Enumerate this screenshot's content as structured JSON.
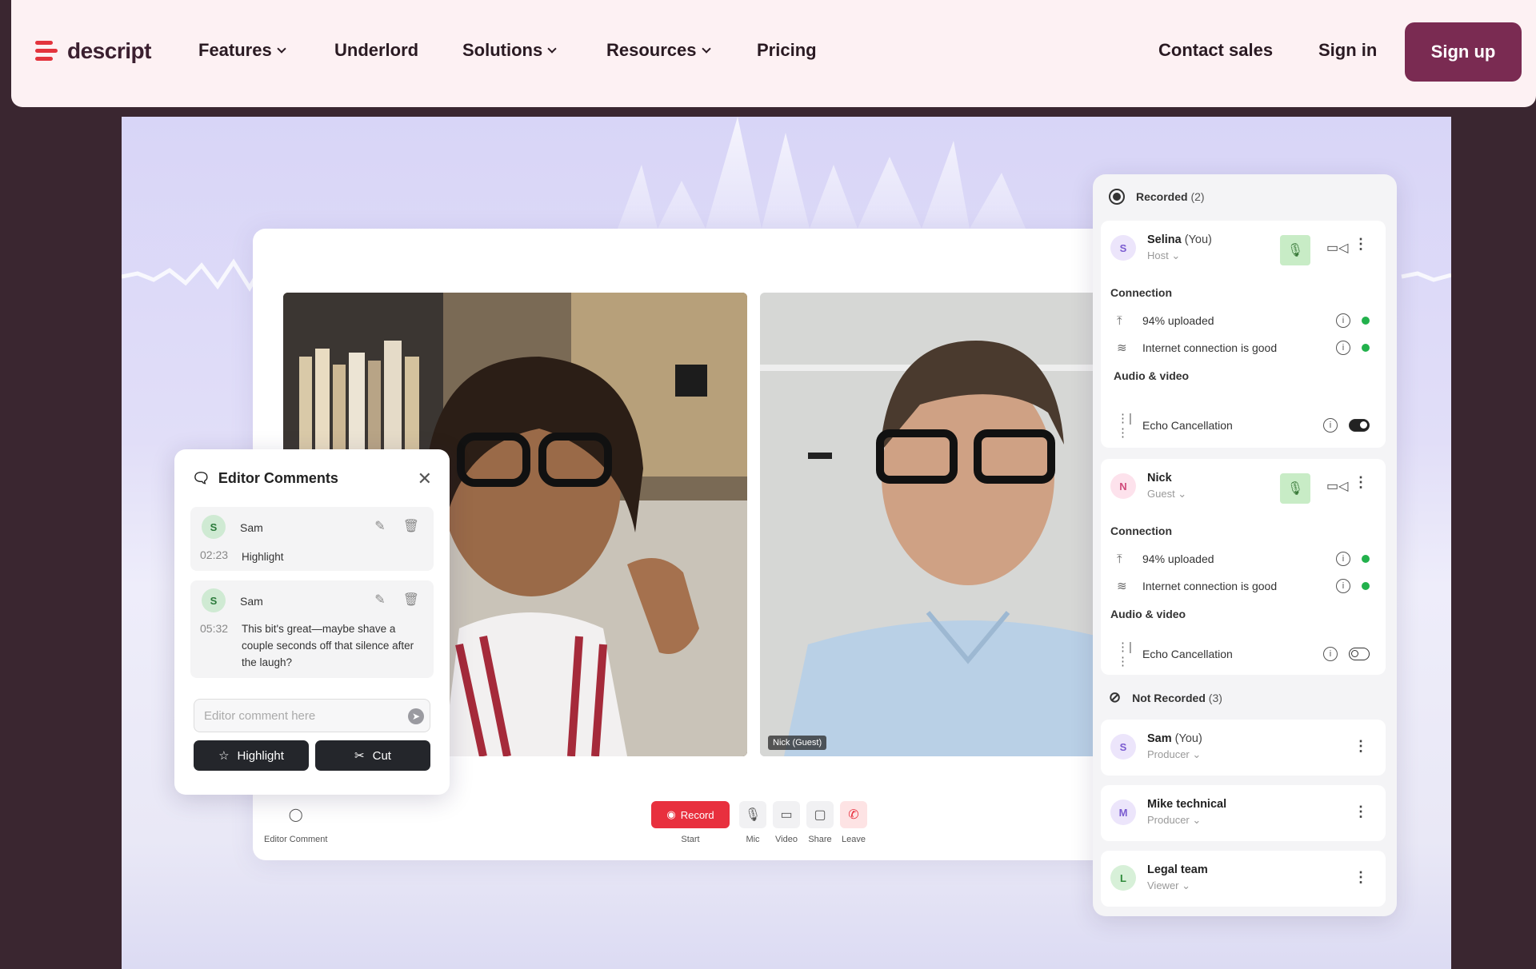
{
  "nav": {
    "brand": "descript",
    "items": [
      {
        "label": "Features",
        "has_dropdown": true
      },
      {
        "label": "Underlord",
        "has_dropdown": false
      },
      {
        "label": "Solutions",
        "has_dropdown": true
      },
      {
        "label": "Resources",
        "has_dropdown": true
      },
      {
        "label": "Pricing",
        "has_dropdown": false
      }
    ],
    "contact_sales": "Contact sales",
    "sign_in": "Sign in",
    "sign_up": "Sign up"
  },
  "colors": {
    "brand_red": "#e3343d",
    "signup_bg": "#7a2b52",
    "page_bg": "#3a2630",
    "record_red": "#e8303e",
    "status_green": "#22b14c"
  },
  "video": {
    "guest_tag": "Nick (Guest)"
  },
  "toolbar": {
    "editor_comment": "Editor Comment",
    "record_label": "Record",
    "start": "Start",
    "mic": "Mic",
    "video": "Video",
    "share": "Share",
    "leave": "Leave"
  },
  "comments": {
    "title": "Editor Comments",
    "items": [
      {
        "initial": "S",
        "name": "Sam",
        "time": "02:23",
        "text": "Highlight"
      },
      {
        "initial": "S",
        "name": "Sam",
        "time": "05:32",
        "text": "This bit's great—maybe shave a couple seconds off that silence after the laugh?"
      }
    ],
    "input_placeholder": "Editor comment here",
    "highlight_label": "Highlight",
    "cut_label": "Cut"
  },
  "panel": {
    "recorded_title": "Recorded",
    "recorded_count": "(2)",
    "not_recorded_title": "Not Recorded",
    "not_recorded_count": "(3)",
    "connection_label": "Connection",
    "av_label": "Audio & video",
    "recorded": [
      {
        "initial": "S",
        "name": "Selina",
        "suffix": "(You)",
        "role": "Host",
        "uploaded": "94% uploaded",
        "internet": "Internet connection is good",
        "echo": "Echo Cancellation",
        "echo_on": true
      },
      {
        "initial": "N",
        "name": "Nick",
        "suffix": "",
        "role": "Guest",
        "uploaded": "94% uploaded",
        "internet": "Internet connection is good",
        "echo": "Echo Cancellation",
        "echo_on": false
      }
    ],
    "not_recorded": [
      {
        "initial": "S",
        "name": "Sam",
        "suffix": "(You)",
        "role": "Producer"
      },
      {
        "initial": "M",
        "name": "Mike technical",
        "suffix": "",
        "role": "Producer"
      },
      {
        "initial": "L",
        "name": "Legal team",
        "suffix": "",
        "role": "Viewer"
      }
    ]
  }
}
